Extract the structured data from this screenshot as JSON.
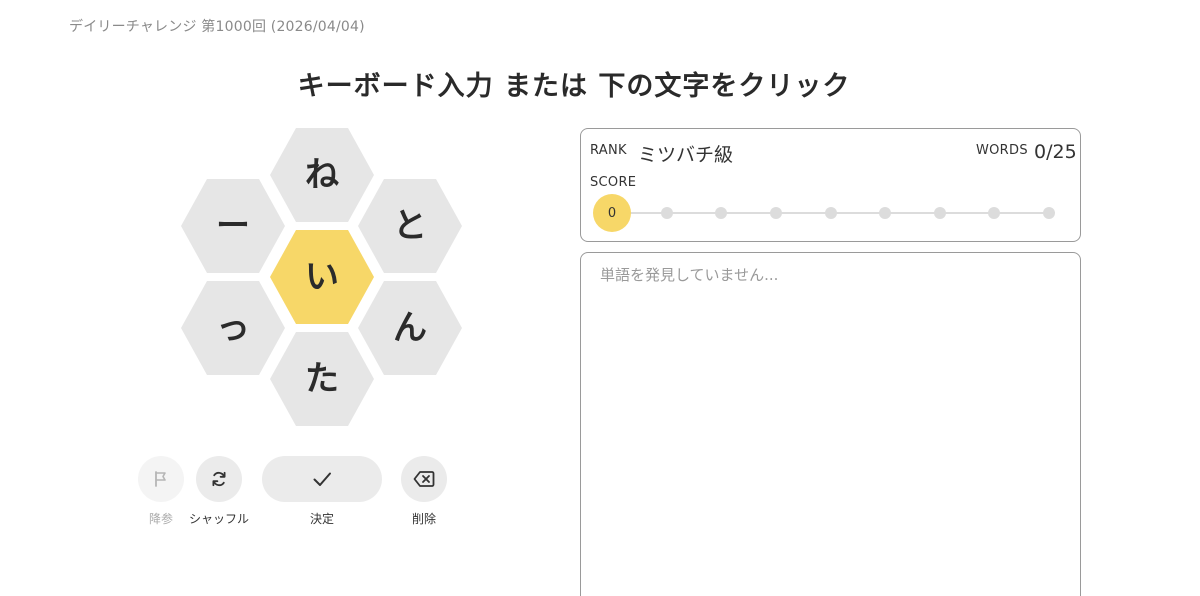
{
  "header": {
    "challenge_label": "デイリーチャレンジ 第1000回 (2026/04/04)",
    "instruction": "キーボード入力 または 下の文字をクリック"
  },
  "hive": {
    "center_letter": "い",
    "outer_letters": [
      "ね",
      "と",
      "ん",
      "た",
      "っ",
      "ー"
    ],
    "colors": {
      "center": "#f7d768",
      "outer": "#e6e6e6"
    }
  },
  "controls": {
    "give_up_label": "降参",
    "shuffle_label": "シャッフル",
    "submit_label": "決定",
    "delete_label": "削除"
  },
  "status": {
    "rank_label": "RANK",
    "rank_value": "ミツバチ級",
    "words_label": "WORDS",
    "words_value": "0/25",
    "score_label": "SCORE",
    "score_value": "0",
    "progress_steps": 9,
    "current_step": 0
  },
  "word_list": {
    "placeholder": "単語を発見していません..."
  }
}
